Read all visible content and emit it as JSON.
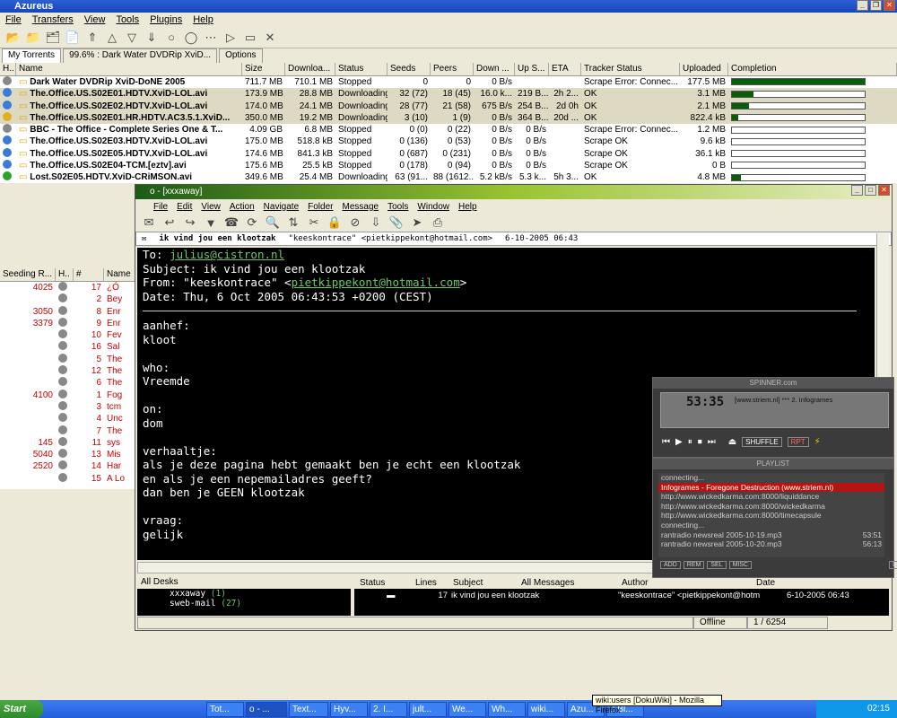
{
  "azureus": {
    "title": "Azureus",
    "menu": [
      "File",
      "Transfers",
      "View",
      "Tools",
      "Plugins",
      "Help"
    ],
    "tabs": [
      "My Torrents",
      "99.6% : Dark Water DVDRip XviD...",
      "Options"
    ],
    "columns": [
      "H..",
      "Name",
      "Size",
      "Downloa...",
      "Status",
      "Seeds",
      "Peers",
      "Down ...",
      "Up S...",
      "ETA",
      "Tracker Status",
      "Uploaded",
      "Completion"
    ],
    "rows": [
      {
        "name": "Dark Water DVDRip XviD-DoNE 2005",
        "size": "711.7 MB",
        "down": "710.1 MB",
        "status": "Stopped",
        "seeds": "0",
        "peers": "0",
        "dspeed": "0 B/s",
        "uspeed": "",
        "eta": "",
        "tracker": "Scrape Error: Connec...",
        "uploaded": "177.5 MB",
        "completion": 0.998,
        "color": "#888"
      },
      {
        "name": "The.Office.US.S02E01.HDTV.XviD-LOL.avi",
        "size": "173.9 MB",
        "down": "28.8 MB",
        "status": "Downloading",
        "seeds": "32 (72)",
        "peers": "18 (45)",
        "dspeed": "16.0 k...",
        "uspeed": "219 B...",
        "eta": "2h 2...",
        "tracker": "OK",
        "uploaded": "3.1 MB",
        "completion": 0.16,
        "color": "#3a7bd5"
      },
      {
        "name": "The.Office.US.S02E02.HDTV.XviD-LOL.avi",
        "size": "174.0 MB",
        "down": "24.1 MB",
        "status": "Downloading",
        "seeds": "28 (77)",
        "peers": "21 (58)",
        "dspeed": "675 B/s",
        "uspeed": "254 B...",
        "eta": "2d 0h",
        "tracker": "OK",
        "uploaded": "2.1 MB",
        "completion": 0.13,
        "color": "#3a7bd5"
      },
      {
        "name": "The.Office.US.S02E01.HR.HDTV.AC3.5.1.XviD...",
        "size": "350.0 MB",
        "down": "19.2 MB",
        "status": "Downloading",
        "seeds": "3 (10)",
        "peers": "1 (9)",
        "dspeed": "0 B/s",
        "uspeed": "364 B...",
        "eta": "20d ...",
        "tracker": "OK",
        "uploaded": "822.4 kB",
        "completion": 0.05,
        "color": "#e0b020"
      },
      {
        "name": "BBC - The Office - Complete Series One & T...",
        "size": "4.09 GB",
        "down": "6.8 MB",
        "status": "Stopped",
        "seeds": "0 (0)",
        "peers": "0 (22)",
        "dspeed": "0 B/s",
        "uspeed": "0 B/s",
        "eta": "",
        "tracker": "Scrape Error: Connec...",
        "uploaded": "1.2 MB",
        "completion": 0.0,
        "color": "#888"
      },
      {
        "name": "The.Office.US.S02E03.HDTV.XviD-LOL.avi",
        "size": "175.0 MB",
        "down": "518.8 kB",
        "status": "Stopped",
        "seeds": "0 (136)",
        "peers": "0 (53)",
        "dspeed": "0 B/s",
        "uspeed": "0 B/s",
        "eta": "",
        "tracker": "Scrape OK",
        "uploaded": "9.6 kB",
        "completion": 0.0,
        "color": "#3a7bd5"
      },
      {
        "name": "The.Office.US.S02E05.HDTV.XviD-LOL.avi",
        "size": "174.6 MB",
        "down": "841.3 kB",
        "status": "Stopped",
        "seeds": "0 (687)",
        "peers": "0 (231)",
        "dspeed": "0 B/s",
        "uspeed": "0 B/s",
        "eta": "",
        "tracker": "Scrape OK",
        "uploaded": "36.1 kB",
        "completion": 0.0,
        "color": "#3a7bd5"
      },
      {
        "name": "The.Office.US.S02E04-TCM.[eztv].avi",
        "size": "175.6 MB",
        "down": "25.5 kB",
        "status": "Stopped",
        "seeds": "0 (178)",
        "peers": "0 (94)",
        "dspeed": "0 B/s",
        "uspeed": "0 B/s",
        "eta": "",
        "tracker": "Scrape OK",
        "uploaded": "0 B",
        "completion": 0.0,
        "color": "#3a7bd5"
      },
      {
        "name": "Lost.S02E05.HDTV.XviD-CRiMSON.avi",
        "size": "349.6 MB",
        "down": "25.4 MB",
        "status": "Downloading",
        "seeds": "63 (91...",
        "peers": "88 (1612...",
        "dspeed": "5.2 kB/s",
        "uspeed": "5.3 k...",
        "eta": "5h 3...",
        "tracker": "OK",
        "uploaded": "4.8 MB",
        "completion": 0.07,
        "color": "#2aa52a"
      }
    ],
    "seed_columns": [
      "Seeding R...",
      "H..",
      "#",
      "Name"
    ],
    "seed_rows": [
      {
        "rank": "4025",
        "num": "17",
        "name": "¿Ó"
      },
      {
        "rank": "",
        "num": "2",
        "name": "Bey"
      },
      {
        "rank": "3050",
        "num": "8",
        "name": "Enr"
      },
      {
        "rank": "3379",
        "num": "9",
        "name": "Enr"
      },
      {
        "rank": "",
        "num": "10",
        "name": "Fev"
      },
      {
        "rank": "",
        "num": "16",
        "name": "Sal"
      },
      {
        "rank": "",
        "num": "5",
        "name": "The"
      },
      {
        "rank": "",
        "num": "12",
        "name": "The"
      },
      {
        "rank": "",
        "num": "6",
        "name": "The"
      },
      {
        "rank": "4100",
        "num": "1",
        "name": "Fog"
      },
      {
        "rank": "",
        "num": "3",
        "name": "tcm"
      },
      {
        "rank": "",
        "num": "4",
        "name": "Unc"
      },
      {
        "rank": "",
        "num": "7",
        "name": "The"
      },
      {
        "rank": "145",
        "num": "11",
        "name": "sys"
      },
      {
        "rank": "5040",
        "num": "13",
        "name": "Mis"
      },
      {
        "rank": "2520",
        "num": "14",
        "name": "Har"
      },
      {
        "rank": "",
        "num": "15",
        "name": "A Lo"
      }
    ]
  },
  "mail": {
    "title": "o - [xxxaway]",
    "menu": [
      "File",
      "Edit",
      "View",
      "Action",
      "Navigate",
      "Folder",
      "Message",
      "Tools",
      "Window",
      "Help"
    ],
    "header_subject": "ik vind jou een klootzak",
    "header_from": "\"keeskontrace\" <pietkippekont@hotmail.com>",
    "header_date": "6-10-2005 06:43",
    "to_label": "To: ",
    "to": "julius@cistron.nl",
    "subject_line": "Subject: ik vind jou een klootzak",
    "from_label": "From: \"keeskontrace\" <",
    "from_email": "pietkippekont@hotmail.com",
    "from_end": ">",
    "date_line": "Date: Thu, 6 Oct 2005 06:43:53 +0200 (CEST)",
    "body": "aanhef:\nkloot\n\nwho:\nVreemde\n\non:\ndom\n\nverhaaltje:\nals je deze pagina hebt gemaakt ben je echt een klootzak\nen als je een nepemailadres geeft?\ndan ben je GEEN klootzak\n\nvraag:\ngelijk",
    "desks_title": "All Desks",
    "desks": [
      {
        "name": "xxxaway",
        "count": "(1)"
      },
      {
        "name": "sweb-mail",
        "count": "(27)"
      }
    ],
    "list_columns": [
      "Status",
      "Lines",
      "Subject",
      "All Messages",
      "Author",
      "Date"
    ],
    "list_rows": [
      {
        "lines": "17",
        "subject": "ik vind jou een klootzak",
        "author": "\"keeskontrace\" <pietkippekont@hotm",
        "date": "6-10-2005 06:43"
      }
    ],
    "status_offline": "Offline",
    "status_count": "1 / 6254"
  },
  "spinner": {
    "title": "SPINNER.com",
    "time": "53:35",
    "station": "[www.striem.nl] *** 2. Infogrames",
    "shuffle": "SHUFFLE",
    "rpt": "RPT",
    "playlist_title": "PLAYLIST",
    "playlist": [
      {
        "text": "connecting...",
        "time": "",
        "active": false
      },
      {
        "text": "Infogrames - Foregone Destruction (www.striem.nl)",
        "time": "",
        "active": true
      },
      {
        "text": "http://www.wickedkarma.com:8000/liquiddance",
        "time": "",
        "active": false
      },
      {
        "text": "http://www.wickedkarma.com:8000/wickedkarma",
        "time": "",
        "active": false
      },
      {
        "text": "http://www.wickedkarma.com:8000/timecapsule",
        "time": "",
        "active": false
      },
      {
        "text": "connecting...",
        "time": "",
        "active": false
      },
      {
        "text": "rantradio newsreal  2005-10-19.mp3",
        "time": "53:51",
        "active": false
      },
      {
        "text": "rantradio newsreal  2005-10-20.mp3",
        "time": "56:13",
        "active": false
      }
    ],
    "pl_buttons": [
      "ADD",
      "REM",
      "SEL",
      "MISC"
    ],
    "list_btn": "LIST"
  },
  "taskbar": {
    "start": "Start",
    "tasks": [
      "Tot...",
      "o - ...",
      "Text...",
      "Hyv...",
      "2. I...",
      "jult...",
      "We...",
      "Wh...",
      "wiki...",
      "Azu...",
      ":: Bl..."
    ],
    "clock": "02:15",
    "tooltip": "wiki:users [DokuWiki] - Mozilla Firefox"
  }
}
